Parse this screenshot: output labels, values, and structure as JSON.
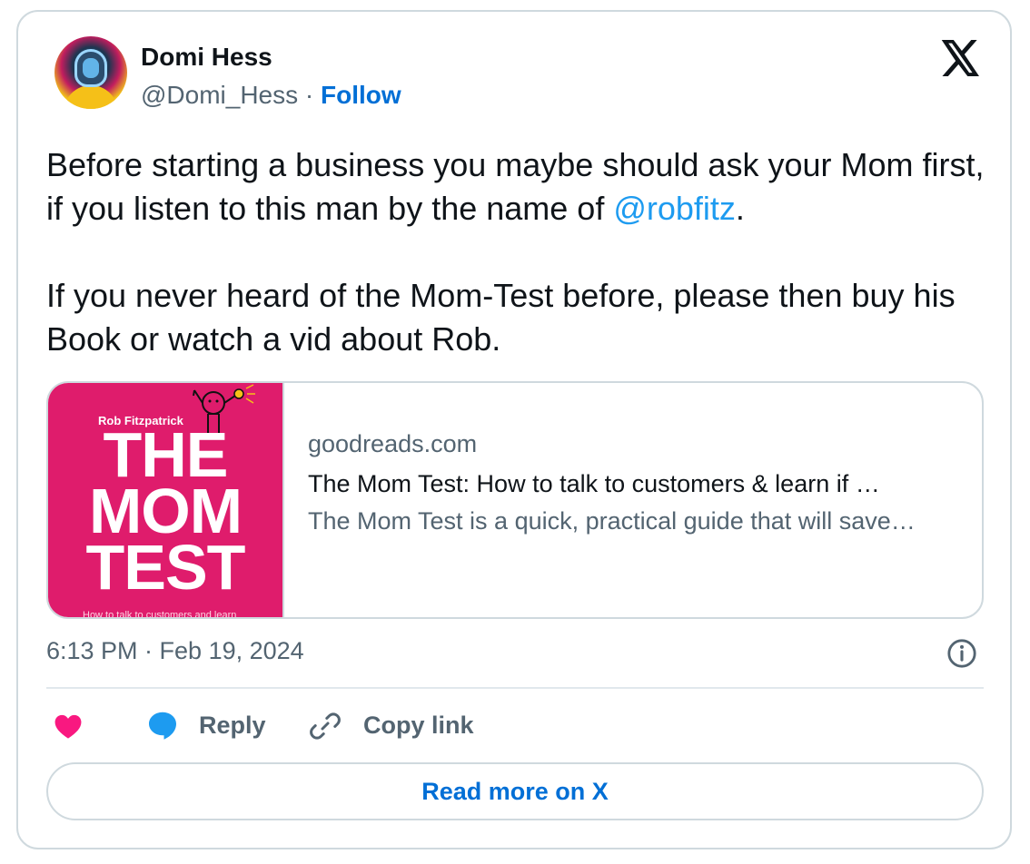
{
  "author": {
    "name": "Domi Hess",
    "handle": "@Domi_Hess",
    "separator": "·",
    "follow_label": "Follow"
  },
  "platform_icon": "x-logo-icon",
  "tweet": {
    "line1_before": "Before starting a business you maybe should ask your Mom first, if you listen to this man by the name of ",
    "mention": "@robfitz",
    "line1_after": ".",
    "line2": "If you never heard of the Mom-Test before, please then buy his Book or watch a vid about Rob."
  },
  "link_card": {
    "image": {
      "author": "Rob Fitzpatrick",
      "title_lines": [
        "THE",
        "MOM",
        "TEST"
      ],
      "subtitle": "How to talk to customers and learn",
      "background": "#df1c6c"
    },
    "domain": "goodreads.com",
    "title": "The Mom Test: How to talk to customers & learn if …",
    "description": "The Mom Test is a quick, practical guide that will save…"
  },
  "timestamp": "6:13 PM · Feb 19, 2024",
  "actions": {
    "like_icon": "heart-icon",
    "reply_label": "Reply",
    "copy_label": "Copy link"
  },
  "read_more_label": "Read more on X",
  "colors": {
    "link": "#006fd6",
    "mention": "#1d9bf0",
    "heart": "#f91880",
    "reply": "#1d9bf0",
    "muted": "#536471",
    "border": "#cfd9de"
  }
}
